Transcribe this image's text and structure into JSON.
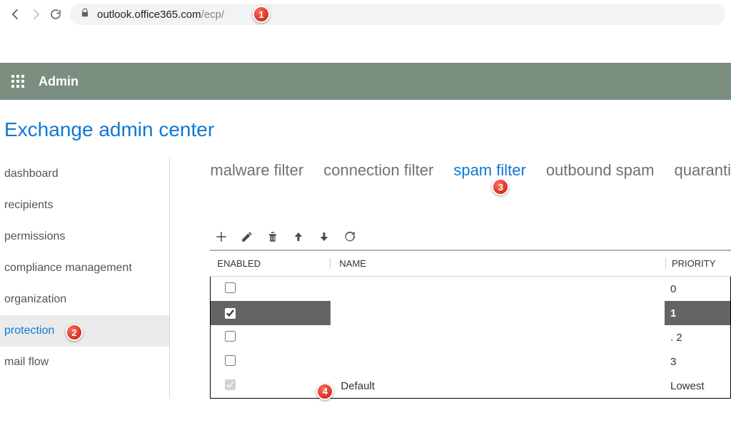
{
  "browser": {
    "url_host": "outlook.office365.com",
    "url_path": "/ecp/"
  },
  "topbar": {
    "app": "Admin"
  },
  "heading": "Exchange admin center",
  "sidebar": {
    "items": [
      {
        "label": "dashboard"
      },
      {
        "label": "recipients"
      },
      {
        "label": "permissions"
      },
      {
        "label": "compliance management"
      },
      {
        "label": "organization"
      },
      {
        "label": "protection",
        "active": true
      },
      {
        "label": "mail flow"
      }
    ]
  },
  "tabs": [
    {
      "label": "malware filter"
    },
    {
      "label": "connection filter"
    },
    {
      "label": "spam filter",
      "active": true
    },
    {
      "label": "outbound spam"
    },
    {
      "label": "quaranti"
    }
  ],
  "toolbar_icons": [
    "add",
    "edit",
    "delete",
    "up",
    "down",
    "refresh"
  ],
  "table": {
    "columns": {
      "enabled": "ENABLED",
      "name": "NAME",
      "priority": "PRIORITY"
    },
    "rows": [
      {
        "enabled": false,
        "name": "",
        "priority": "0"
      },
      {
        "enabled": true,
        "name": "",
        "priority": "1",
        "selected": true
      },
      {
        "enabled": false,
        "name": "",
        "priority": "2",
        "priority_prefix": ".  "
      },
      {
        "enabled": false,
        "name": "",
        "priority": "3"
      },
      {
        "enabled": true,
        "name": "Default",
        "priority": "Lowest",
        "locked": true
      }
    ]
  },
  "annotations": {
    "b1": "1",
    "b2": "2",
    "b3": "3",
    "b4": "4"
  }
}
